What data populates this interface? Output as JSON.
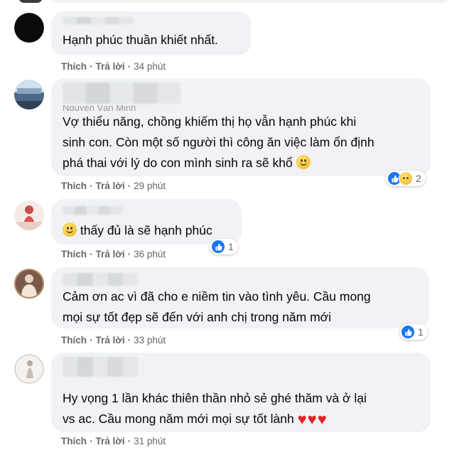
{
  "comments": [
    {
      "name_hint": "",
      "text": "Hạnh phúc thuần khiết nhất.",
      "actions": {
        "like": "Thích",
        "reply": "Trả lời",
        "time": "34 phút"
      },
      "reaction": null
    },
    {
      "name_hint": "Nguyễn Văn Minh",
      "text": "Vợ thiểu năng, chồng khiếm thị họ vẫn hạnh phúc khi\nsinh con. Còn một số người thì công ăn việc làm ổn định\nphá thai với lý do con mình sinh ra sẽ khổ",
      "actions": {
        "like": "Thích",
        "reply": "Trả lời",
        "time": "29 phút"
      },
      "reaction": {
        "count": "2",
        "icons": [
          "like-icon",
          "sad-icon"
        ]
      }
    },
    {
      "name_hint": "",
      "text": "thấy đủ là sẽ hạnh phúc",
      "actions": {
        "like": "Thích",
        "reply": "Trả lời",
        "time": "36 phút"
      },
      "reaction": {
        "count": "1",
        "icons": [
          "like-icon"
        ]
      }
    },
    {
      "name_hint": "",
      "text": "Cảm ơn ac vì đã cho e niềm tin vào tình yêu. Cầu mong\nmọi sự tốt đẹp sẽ đến với anh chị trong năm mới",
      "actions": {
        "like": "Thích",
        "reply": "Trả lời",
        "time": "33 phút"
      },
      "reaction": {
        "count": "1",
        "icons": [
          "like-icon"
        ]
      }
    },
    {
      "name_hint": "",
      "text": "Hy vọng 1 lần khác thiên thần nhỏ sẻ ghé thăm và ở lại\nvs ac. Cầu mong năm mới mọi sự tốt lành",
      "actions": {
        "like": "Thích",
        "reply": "Trả lời",
        "time": "31 phút"
      },
      "reaction": null
    }
  ],
  "colors": {
    "bubble": "#f0f2f5",
    "meta": "#65676b",
    "like_blue": "#1877f2",
    "heart": "#e02424"
  }
}
